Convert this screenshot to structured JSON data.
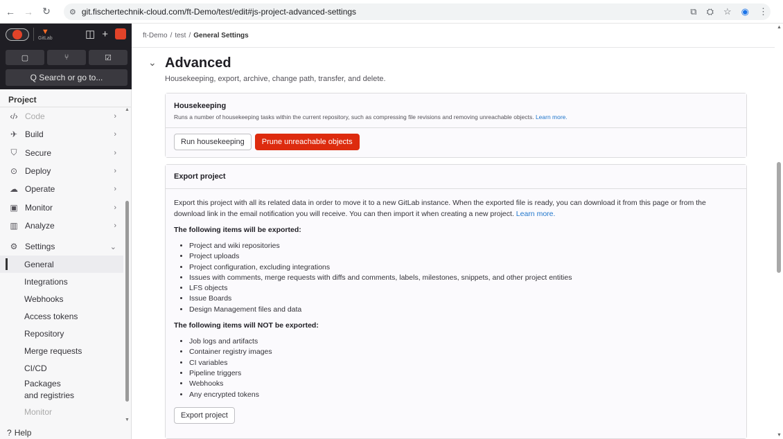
{
  "browser": {
    "url": "git.fischertechnik-cloud.com/ft-Demo/test/edit#js-project-advanced-settings"
  },
  "sidebar": {
    "search_label": "Q Search or go to...",
    "section_title": "Project",
    "items": [
      {
        "label": "Code",
        "icon": "code-icon"
      },
      {
        "label": "Build",
        "icon": "rocket-icon"
      },
      {
        "label": "Secure",
        "icon": "shield-icon"
      },
      {
        "label": "Deploy",
        "icon": "deploy-icon"
      },
      {
        "label": "Operate",
        "icon": "cloud-icon"
      },
      {
        "label": "Monitor",
        "icon": "monitor-icon"
      },
      {
        "label": "Analyze",
        "icon": "chart-icon"
      },
      {
        "label": "Settings",
        "icon": "gear-icon"
      }
    ],
    "settings_sub": [
      "General",
      "Integrations",
      "Webhooks",
      "Access tokens",
      "Repository",
      "Merge requests",
      "CI/CD",
      "Packages and registries",
      "Monitor"
    ],
    "help_label": "Help"
  },
  "breadcrumb": {
    "group": "ft-Demo",
    "project": "test",
    "current": "General Settings"
  },
  "advanced": {
    "title": "Advanced",
    "description": "Housekeeping, export, archive, change path, transfer, and delete."
  },
  "housekeeping": {
    "title": "Housekeeping",
    "description": "Runs a number of housekeeping tasks within the current repository, such as compressing file revisions and removing unreachable objects.",
    "learn_more": "Learn more.",
    "run_label": "Run housekeeping",
    "prune_label": "Prune unreachable objects"
  },
  "export": {
    "title": "Export project",
    "description": "Export this project with all its related data in order to move it to a new GitLab instance. When the exported file is ready, you can download it from this page or from the download link in the email notification you will receive. You can then import it when creating a new project.",
    "learn_more": "Learn more.",
    "exported_heading": "The following items will be exported:",
    "exported_items": [
      "Project and wiki repositories",
      "Project uploads",
      "Project configuration, excluding integrations",
      "Issues with comments, merge requests with diffs and comments, labels, milestones, snippets, and other project entities",
      "LFS objects",
      "Issue Boards",
      "Design Management files and data"
    ],
    "not_exported_heading": "The following items will NOT be exported:",
    "not_exported_items": [
      "Job logs and artifacts",
      "Container registry images",
      "CI variables",
      "Pipeline triggers",
      "Webhooks",
      "Any encrypted tokens"
    ],
    "button_label": "Export project"
  }
}
